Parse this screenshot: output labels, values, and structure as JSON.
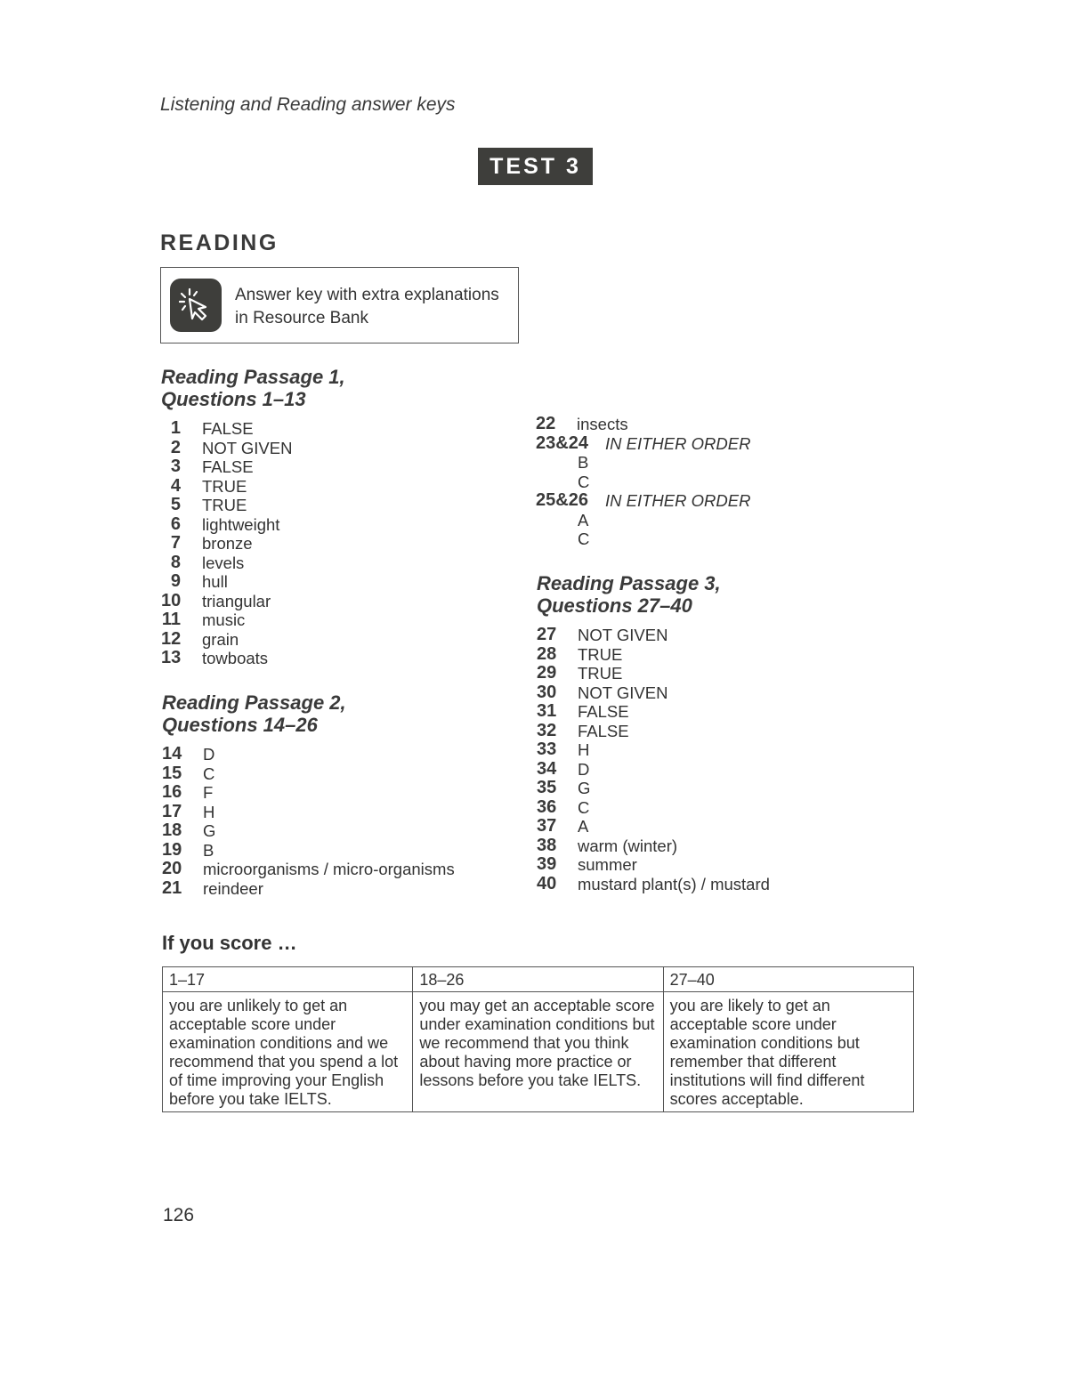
{
  "running_head": "Listening and Reading answer keys",
  "test_badge": "TEST 3",
  "section_title": "READING",
  "resource_box": {
    "icon": "cursor-click-icon",
    "line1": "Answer key with extra explanations",
    "line2": "in Resource Bank"
  },
  "passage1": {
    "heading_line1": "Reading Passage 1,",
    "heading_line2": "Questions 1–13",
    "answers": [
      {
        "num": "1",
        "answer": "FALSE"
      },
      {
        "num": "2",
        "answer": "NOT GIVEN"
      },
      {
        "num": "3",
        "answer": "FALSE"
      },
      {
        "num": "4",
        "answer": "TRUE"
      },
      {
        "num": "5",
        "answer": "TRUE"
      },
      {
        "num": "6",
        "answer": "lightweight"
      },
      {
        "num": "7",
        "answer": "bronze"
      },
      {
        "num": "8",
        "answer": "levels"
      },
      {
        "num": "9",
        "answer": "hull"
      },
      {
        "num": "10",
        "answer": "triangular"
      },
      {
        "num": "11",
        "answer": "music"
      },
      {
        "num": "12",
        "answer": "grain"
      },
      {
        "num": "13",
        "answer": "towboats"
      }
    ]
  },
  "passage2": {
    "heading_line1": "Reading Passage 2,",
    "heading_line2": "Questions 14–26",
    "answers": [
      {
        "num": "14",
        "answer": "D"
      },
      {
        "num": "15",
        "answer": "C"
      },
      {
        "num": "16",
        "answer": "F"
      },
      {
        "num": "17",
        "answer": "H"
      },
      {
        "num": "18",
        "answer": "G"
      },
      {
        "num": "19",
        "answer": "B"
      },
      {
        "num": "20",
        "answer": "microorganisms / micro-organisms"
      },
      {
        "num": "21",
        "answer": "reindeer"
      },
      {
        "num": "22",
        "answer": "insects"
      }
    ],
    "combined": [
      {
        "num": "23&24",
        "label": "IN EITHER ORDER",
        "answers": [
          "B",
          "C"
        ]
      },
      {
        "num": "25&26",
        "label": "IN EITHER ORDER",
        "answers": [
          "A",
          "C"
        ]
      }
    ]
  },
  "passage3": {
    "heading_line1": "Reading Passage 3,",
    "heading_line2": "Questions 27–40",
    "answers": [
      {
        "num": "27",
        "answer": "NOT GIVEN"
      },
      {
        "num": "28",
        "answer": "TRUE"
      },
      {
        "num": "29",
        "answer": "TRUE"
      },
      {
        "num": "30",
        "answer": "NOT GIVEN"
      },
      {
        "num": "31",
        "answer": "FALSE"
      },
      {
        "num": "32",
        "answer": "FALSE"
      },
      {
        "num": "33",
        "answer": "H"
      },
      {
        "num": "34",
        "answer": "D"
      },
      {
        "num": "35",
        "answer": "G"
      },
      {
        "num": "36",
        "answer": "C"
      },
      {
        "num": "37",
        "answer": "A"
      },
      {
        "num": "38",
        "answer": "warm (winter)"
      },
      {
        "num": "39",
        "answer": "summer"
      },
      {
        "num": "40",
        "answer": "mustard plant(s) / mustard"
      }
    ]
  },
  "score_section": {
    "title": "If you score …",
    "columns": [
      {
        "range": "1–17",
        "text": "you are unlikely to get an acceptable score under examination conditions and we recommend that you spend a lot of time improving your English before you take IELTS."
      },
      {
        "range": "18–26",
        "text": "you may get an acceptable score under examination conditions but we recommend that you think about having more practice or lessons before you take IELTS."
      },
      {
        "range": "27–40",
        "text": "you are likely to get an acceptable score under examination conditions but remember that different institutions will find different scores acceptable."
      }
    ]
  },
  "page_number": "126"
}
